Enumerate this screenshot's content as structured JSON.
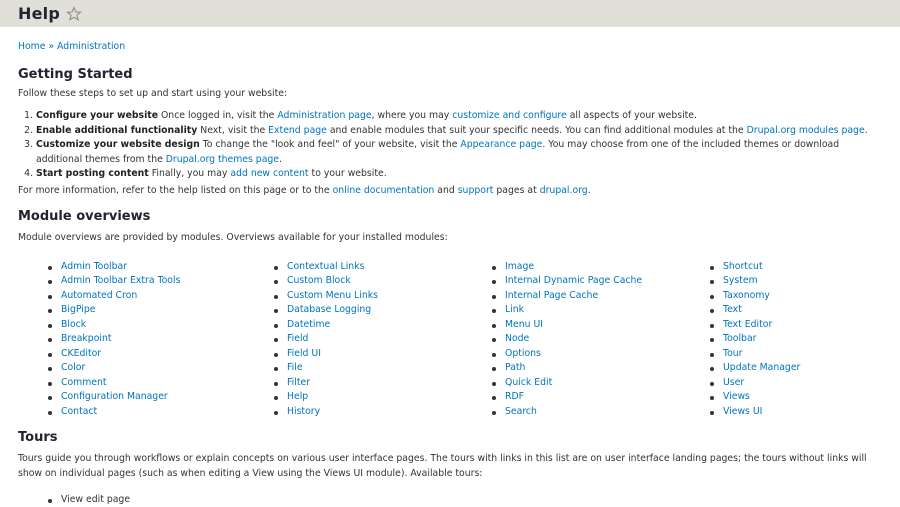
{
  "header": {
    "title": "Help",
    "shortcut_icon": "star-outline-icon"
  },
  "breadcrumb": {
    "items": [
      "Home",
      "Administration"
    ],
    "separator": "»"
  },
  "getting_started": {
    "heading": "Getting Started",
    "intro": "Follow these steps to set up and start using your website:",
    "steps": [
      {
        "num": "1.",
        "title": "Configure your website",
        "t1": " Once logged in, visit the ",
        "l1": "Administration page",
        "t2": ", where you may ",
        "l2": "customize and configure",
        "t3": " all aspects of your website."
      },
      {
        "num": "2.",
        "title": "Enable additional functionality",
        "t1": " Next, visit the ",
        "l1": "Extend page",
        "t2": " and enable modules that suit your specific needs. You can find additional modules at the ",
        "l2": "Drupal.org modules page",
        "t3": "."
      },
      {
        "num": "3.",
        "title": "Customize your website design",
        "t1": " To change the \"look and feel\" of your website, visit the ",
        "l1": "Appearance page",
        "t2": ". You may choose from one of the included themes or download additional themes from the ",
        "l2": "Drupal.org themes page",
        "t3": "."
      },
      {
        "num": "4.",
        "title": "Start posting content",
        "t1": " Finally, you may ",
        "l1": "add new content",
        "t2": " to your website."
      }
    ],
    "more": {
      "t1": "For more information, refer to the help listed on this page or to the ",
      "l1": "online documentation",
      "t2": " and ",
      "l2": "support",
      "t3": " pages at ",
      "l3": "drupal.org",
      "t4": "."
    }
  },
  "module_overviews": {
    "heading": "Module overviews",
    "intro": "Module overviews are provided by modules. Overviews available for your installed modules:",
    "columns": [
      [
        "Admin Toolbar",
        "Admin Toolbar Extra Tools",
        "Automated Cron",
        "BigPipe",
        "Block",
        "Breakpoint",
        "CKEditor",
        "Color",
        "Comment",
        "Configuration Manager",
        "Contact"
      ],
      [
        "Contextual Links",
        "Custom Block",
        "Custom Menu Links",
        "Database Logging",
        "Datetime",
        "Field",
        "Field UI",
        "File",
        "Filter",
        "Help",
        "History"
      ],
      [
        "Image",
        "Internal Dynamic Page Cache",
        "Internal Page Cache",
        "Link",
        "Menu UI",
        "Node",
        "Options",
        "Path",
        "Quick Edit",
        "RDF",
        "Search"
      ],
      [
        "Shortcut",
        "System",
        "Taxonomy",
        "Text",
        "Text Editor",
        "Toolbar",
        "Tour",
        "Update Manager",
        "User",
        "Views",
        "Views UI"
      ]
    ]
  },
  "tours": {
    "heading": "Tours",
    "intro": "Tours guide you through workflows or explain concepts on various user interface pages. The tours with links in this list are on user interface landing pages; the tours without links will show on individual pages (such as when editing a View using the Views UI module). Available tours:",
    "items": [
      "View edit page"
    ]
  },
  "colors": {
    "link": "#0074bd",
    "header_bg": "#e0e0d8",
    "text": "#333333",
    "heading": "#222330"
  }
}
